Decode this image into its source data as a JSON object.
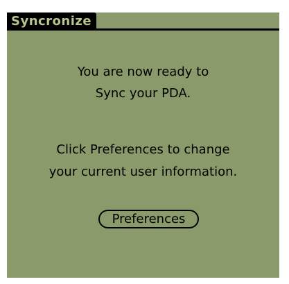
{
  "window": {
    "title": "Syncronize"
  },
  "message": {
    "line1": "You are now ready to",
    "line2": "Sync your PDA.",
    "line3": "Click Preferences to change",
    "line4": "your current user information."
  },
  "buttons": {
    "preferences_label": "Preferences"
  },
  "colors": {
    "screen_background": "#8a9a6a",
    "title_background": "#000000",
    "title_text": "#b8c58d",
    "text": "#000000"
  }
}
